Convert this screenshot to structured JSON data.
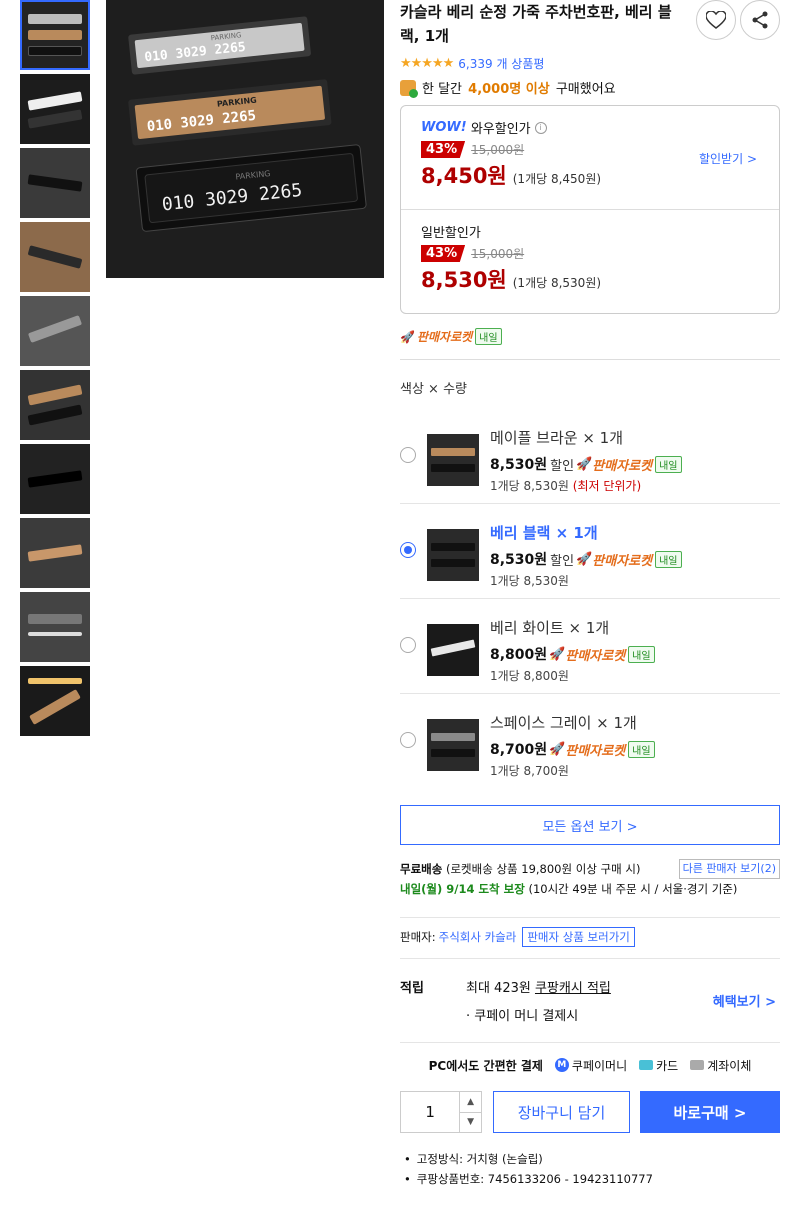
{
  "product": {
    "title": "카슬라 베리 순정 가죽 주차번호판, 베리 블랙, 1개",
    "rating_stars": "★★★★★",
    "review_count": "6,339 개 상품평",
    "bought_prefix": "한 달간",
    "bought_count": "4,000명 이상",
    "bought_suffix": "구매했어요"
  },
  "gallery": {
    "plate_number": "010 3029 2265",
    "plate_label": "PARKING",
    "thumb_count": 10
  },
  "price": {
    "wow_logo": "WOW!",
    "wow_label": "와우할인가",
    "wow_info": "i",
    "wow_discount": "43%",
    "wow_original": "15,000원",
    "wow_price": "8,450원",
    "wow_unit": "(1개당 8,450원)",
    "discount_link": "할인받기 >",
    "normal_label": "일반할인가",
    "normal_discount": "43%",
    "normal_original": "15,000원",
    "normal_price": "8,530원",
    "normal_unit": "(1개당 8,530원)"
  },
  "rocket": {
    "label": "판매자로켓",
    "tag": "내일"
  },
  "options": {
    "title": "색상 × 수량",
    "items": [
      {
        "name": "메이플 브라운 × 1개",
        "price": "8,530원",
        "sale": "할인",
        "rocket": "판매자로켓",
        "tag": "내일",
        "unit": "1개당 8,530원",
        "lowest": "(최저 단위가)",
        "selected": false,
        "color": "#b98a5c"
      },
      {
        "name": "베리 블랙 × 1개",
        "price": "8,530원",
        "sale": "할인",
        "rocket": "판매자로켓",
        "tag": "내일",
        "unit": "1개당 8,530원",
        "lowest": "",
        "selected": true,
        "color": "#111111"
      },
      {
        "name": "베리 화이트 × 1개",
        "price": "8,800원",
        "sale": "",
        "rocket": "판매자로켓",
        "tag": "내일",
        "unit": "1개당 8,800원",
        "lowest": "",
        "selected": false,
        "color": "#e8e8e8"
      },
      {
        "name": "스페이스 그레이 × 1개",
        "price": "8,700원",
        "sale": "",
        "rocket": "판매자로켓",
        "tag": "내일",
        "unit": "1개당 8,700원",
        "lowest": "",
        "selected": false,
        "color": "#8a8a8a"
      }
    ],
    "all_options": "모든 옵션 보기 >"
  },
  "shipping": {
    "free_label": "무료배송",
    "free_desc": "(로켓배송 상품 19,800원 이상 구매 시)",
    "other_seller": "다른 판매자 보기(2)",
    "arrival": "내일(월) 9/14 도착 보장",
    "arrival_desc": "(10시간 49분 내 주문 시 / 서울·경기 기준)"
  },
  "seller": {
    "label": "판매자:",
    "name": "주식회사 카슬라",
    "button": "판매자 상품 보러가기"
  },
  "points": {
    "label": "적립",
    "line1_prefix": "최대 423원",
    "line1_link": "쿠팡캐시 적립",
    "line2": "· 쿠페이 머니 결제시",
    "benefit": "혜택보기 >"
  },
  "payment": {
    "label": "PC에서도 간편한 결제",
    "m": "M",
    "coupay": "쿠페이머니",
    "card": "카드",
    "bank": "계좌이체"
  },
  "purchase": {
    "qty": "1",
    "up": "▲",
    "down": "▼",
    "cart": "장바구니 담기",
    "buy": "바로구매 >"
  },
  "specs": [
    "고정방식: 거치형 (논슬립)",
    "쿠팡상품번호: 7456133206 - 19423110777"
  ],
  "colors": {
    "accent": "#346aff",
    "price_red": "#ae0000",
    "badge_red": "#cc0000",
    "rocket_orange": "#e46d1c",
    "brown": "#b98a5c"
  }
}
